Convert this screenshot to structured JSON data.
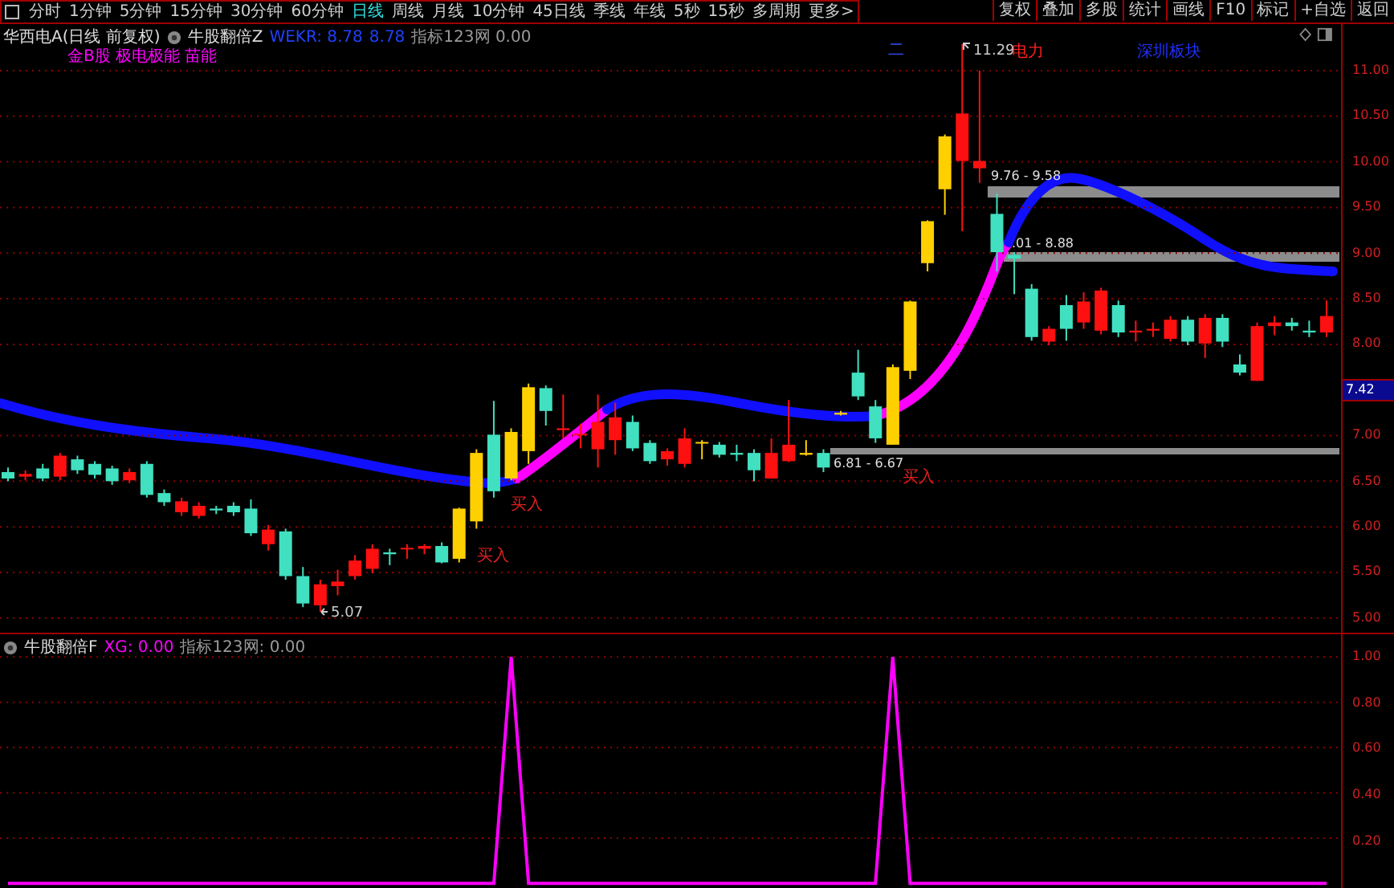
{
  "toolbar": {
    "periods": [
      {
        "label": "分时",
        "selected": false
      },
      {
        "label": "1分钟",
        "selected": false
      },
      {
        "label": "5分钟",
        "selected": false
      },
      {
        "label": "15分钟",
        "selected": false
      },
      {
        "label": "30分钟",
        "selected": false
      },
      {
        "label": "60分钟",
        "selected": false
      },
      {
        "label": "日线",
        "selected": true
      },
      {
        "label": "周线",
        "selected": false
      },
      {
        "label": "月线",
        "selected": false
      },
      {
        "label": "10分钟",
        "selected": false
      },
      {
        "label": "45日线",
        "selected": false
      },
      {
        "label": "季线",
        "selected": false
      },
      {
        "label": "年线",
        "selected": false
      },
      {
        "label": "5秒",
        "selected": false
      },
      {
        "label": "15秒",
        "selected": false
      },
      {
        "label": "多周期",
        "selected": false
      },
      {
        "label": "更多>",
        "selected": false
      }
    ],
    "buttons": [
      "复权",
      "叠加",
      "多股",
      "统计",
      "画线",
      "F10",
      "标记",
      "+自选",
      "返回"
    ]
  },
  "main_panel": {
    "header": {
      "security": "华西电A(日线 前复权)",
      "indicator": "牛股翻倍Z",
      "wekr": "WEKR: 8.78",
      "wekr_value_2": "8.78",
      "site_value": "指标123网 0.00"
    },
    "tags": "金B股 极电极能 苗能",
    "annotations": [
      {
        "kind": "mark",
        "text": "二"
      },
      {
        "kind": "price",
        "text": "11.29"
      },
      {
        "kind": "sector",
        "text": "电力"
      },
      {
        "kind": "sector",
        "text": "深圳板块"
      },
      {
        "kind": "price",
        "text": "5.07"
      },
      {
        "kind": "signal",
        "text": "买入"
      },
      {
        "kind": "signal",
        "text": "买入"
      },
      {
        "kind": "signal",
        "text": "买入"
      }
    ],
    "zones": [
      {
        "label": "9.76 - 9.58"
      },
      {
        "label": ".01 - 8.88"
      },
      {
        "label": "6.81 - 6.67"
      }
    ],
    "last_price": "7.42",
    "chart_data": {
      "type": "candlestick",
      "ylim": [
        4.84,
        11.51
      ],
      "grid": true,
      "yticks": [
        {
          "value": 11,
          "label": "11.00"
        },
        {
          "value": 10.5,
          "label": "10.50"
        },
        {
          "value": 10,
          "label": "10.00"
        },
        {
          "value": 9.5,
          "label": "9.50"
        },
        {
          "value": 9,
          "label": "9.00"
        },
        {
          "value": 8.5,
          "label": "8.50"
        },
        {
          "value": 8,
          "label": "8.00"
        },
        {
          "value": 7,
          "label": "7.00"
        },
        {
          "value": 6.5,
          "label": "6.50"
        },
        {
          "value": 6,
          "label": "6.00"
        },
        {
          "value": 5.5,
          "label": "5.50"
        },
        {
          "value": 5,
          "label": "5.00"
        }
      ],
      "ohlc": [
        [
          6.6,
          6.65,
          6.5,
          6.53
        ],
        [
          6.55,
          6.62,
          6.51,
          6.58
        ],
        [
          6.64,
          6.69,
          6.5,
          6.53
        ],
        [
          6.55,
          6.81,
          6.51,
          6.78
        ],
        [
          6.74,
          6.78,
          6.58,
          6.62
        ],
        [
          6.69,
          6.72,
          6.53,
          6.57
        ],
        [
          6.64,
          6.67,
          6.46,
          6.5
        ],
        [
          6.51,
          6.64,
          6.48,
          6.6
        ],
        [
          6.69,
          6.72,
          6.32,
          6.35
        ],
        [
          6.37,
          6.41,
          6.23,
          6.27
        ],
        [
          6.16,
          6.32,
          6.12,
          6.28
        ],
        [
          6.12,
          6.27,
          6.09,
          6.23
        ],
        [
          6.2,
          6.23,
          6.14,
          6.18
        ],
        [
          6.23,
          6.27,
          6.12,
          6.16
        ],
        [
          6.2,
          6.3,
          5.9,
          5.93
        ],
        [
          5.81,
          6.02,
          5.74,
          5.97
        ],
        [
          5.95,
          5.98,
          5.42,
          5.46
        ],
        [
          5.46,
          5.56,
          5.12,
          5.16
        ],
        [
          5.14,
          5.42,
          5.07,
          5.37
        ],
        [
          5.35,
          5.53,
          5.25,
          5.4
        ],
        [
          5.46,
          5.69,
          5.42,
          5.63
        ],
        [
          5.54,
          5.81,
          5.49,
          5.76
        ],
        [
          5.72,
          5.76,
          5.58,
          5.7
        ],
        [
          5.76,
          5.81,
          5.65,
          5.77
        ],
        [
          5.76,
          5.81,
          5.7,
          5.79
        ],
        [
          5.79,
          5.83,
          5.6,
          5.61
        ],
        [
          5.65,
          6.21,
          5.61,
          6.2
        ],
        [
          6.06,
          6.85,
          5.98,
          6.81
        ],
        [
          7.01,
          7.38,
          6.32,
          6.39
        ],
        [
          6.53,
          7.08,
          6.51,
          7.04
        ],
        [
          6.83,
          7.57,
          6.69,
          7.53
        ],
        [
          7.52,
          7.55,
          7.11,
          7.27
        ],
        [
          7.06,
          7.45,
          6.97,
          7.08
        ],
        [
          7.01,
          7.13,
          6.86,
          7.02
        ],
        [
          6.85,
          7.45,
          6.65,
          7.15
        ],
        [
          6.95,
          7.36,
          6.79,
          7.2
        ],
        [
          7.15,
          7.22,
          6.83,
          6.86
        ],
        [
          6.92,
          6.95,
          6.69,
          6.72
        ],
        [
          6.74,
          6.86,
          6.67,
          6.83
        ],
        [
          6.69,
          7.08,
          6.65,
          6.97
        ],
        [
          6.92,
          6.95,
          6.74,
          6.93
        ],
        [
          6.9,
          6.93,
          6.76,
          6.79
        ],
        [
          6.81,
          6.9,
          6.72,
          6.79
        ],
        [
          6.81,
          6.85,
          6.5,
          6.62
        ],
        [
          6.53,
          6.97,
          6.53,
          6.81
        ],
        [
          6.72,
          7.39,
          6.71,
          6.9
        ],
        [
          6.79,
          6.95,
          6.78,
          6.81
        ],
        [
          6.81,
          6.85,
          6.6,
          6.65
        ],
        [
          7.23,
          7.27,
          7.22,
          7.25
        ],
        [
          7.69,
          7.94,
          7.39,
          7.43
        ],
        [
          7.32,
          7.39,
          6.92,
          6.97
        ],
        [
          6.9,
          7.78,
          6.9,
          7.75
        ],
        [
          7.71,
          8.48,
          7.62,
          8.47
        ],
        [
          8.89,
          9.36,
          8.8,
          9.35
        ],
        [
          9.7,
          10.3,
          9.42,
          10.28
        ],
        [
          10.01,
          11.29,
          9.24,
          10.53
        ],
        [
          9.93,
          11.0,
          9.77,
          10.01
        ],
        [
          9.43,
          9.65,
          8.8,
          9.01
        ],
        [
          8.98,
          9.01,
          8.55,
          8.94
        ],
        [
          8.61,
          8.66,
          8.04,
          8.08
        ],
        [
          8.03,
          8.2,
          7.99,
          8.17
        ],
        [
          8.43,
          8.54,
          8.04,
          8.17
        ],
        [
          8.24,
          8.57,
          8.17,
          8.47
        ],
        [
          8.15,
          8.62,
          8.11,
          8.59
        ],
        [
          8.43,
          8.48,
          8.08,
          8.13
        ],
        [
          8.13,
          8.26,
          8.03,
          8.15
        ],
        [
          8.15,
          8.24,
          8.08,
          8.17
        ],
        [
          8.06,
          8.31,
          8.03,
          8.27
        ],
        [
          8.27,
          8.31,
          7.99,
          8.03
        ],
        [
          8.01,
          8.33,
          7.85,
          8.29
        ],
        [
          8.29,
          8.33,
          7.97,
          8.03
        ],
        [
          7.78,
          7.89,
          7.66,
          7.69
        ],
        [
          7.6,
          8.24,
          7.6,
          8.2
        ],
        [
          8.2,
          8.31,
          8.1,
          8.24
        ],
        [
          8.24,
          8.29,
          8.15,
          8.2
        ],
        [
          8.15,
          8.26,
          8.08,
          8.13
        ],
        [
          8.13,
          8.48,
          8.08,
          8.31
        ]
      ],
      "colors": [
        "#40e0c0",
        "#ff1010",
        "#40e0c0",
        "#ff1010",
        "#40e0c0",
        "#40e0c0",
        "#40e0c0",
        "#ff1010",
        "#40e0c0",
        "#40e0c0",
        "#ff1010",
        "#ff1010",
        "#40e0c0",
        "#40e0c0",
        "#40e0c0",
        "#ff1010",
        "#40e0c0",
        "#40e0c0",
        "#ff1010",
        "#ff1010",
        "#ff1010",
        "#ff1010",
        "#40e0c0",
        "#ff1010",
        "#ff1010",
        "#40e0c0",
        "#ffd000",
        "#ffd000",
        "#40e0c0",
        "#ffd000",
        "#ffd000",
        "#40e0c0",
        "#ff1010",
        "#ff1010",
        "#ff1010",
        "#ff1010",
        "#40e0c0",
        "#40e0c0",
        "#ff1010",
        "#ff1010",
        "#ffd000",
        "#40e0c0",
        "#40e0c0",
        "#40e0c0",
        "#ff1010",
        "#ff1010",
        "#ffd000",
        "#40e0c0",
        "#ffd000",
        "#40e0c0",
        "#40e0c0",
        "#ffd000",
        "#ffd000",
        "#ffd000",
        "#ffd000",
        "#ff1010",
        "#ff1010",
        "#40e0c0",
        "#40e0c0",
        "#40e0c0",
        "#ff1010",
        "#40e0c0",
        "#ff1010",
        "#ff1010",
        "#40e0c0",
        "#ff1010",
        "#ff1010",
        "#ff1010",
        "#40e0c0",
        "#ff1010",
        "#40e0c0",
        "#40e0c0",
        "#ff1010",
        "#ff1010",
        "#40e0c0",
        "#40e0c0",
        "#ff1010"
      ]
    }
  },
  "lower_panel": {
    "header": {
      "indicator": "牛股翻倍F",
      "xg": "XG: 0.00",
      "site_value": "指标123网: 0.00"
    },
    "chart_data": {
      "type": "line",
      "ylim": [
        -0.02,
        1.1
      ],
      "grid": true,
      "yticks": [
        {
          "value": 0.2,
          "label": "0.20"
        },
        {
          "value": 0.4,
          "label": "0.40"
        },
        {
          "value": 0.6,
          "label": "0.60"
        },
        {
          "value": 0.8,
          "label": "0.80"
        },
        {
          "value": 1,
          "label": "1.00"
        }
      ],
      "series": [
        {
          "color": "#ff00ff",
          "values": [
            0,
            0,
            0,
            0,
            0,
            0,
            0,
            0,
            0,
            0,
            0,
            0,
            0,
            0,
            0,
            0,
            0,
            0,
            0,
            0,
            0,
            0,
            0,
            0,
            0,
            0,
            0,
            0,
            0,
            1,
            0,
            0,
            0,
            0,
            0,
            0,
            0,
            0,
            0,
            0,
            0,
            0,
            0,
            0,
            0,
            0,
            0,
            0,
            0,
            0,
            0,
            1,
            0,
            0,
            0,
            0,
            0,
            0,
            0,
            0,
            0,
            0,
            0,
            0,
            0,
            0,
            0,
            0,
            0,
            0,
            0,
            0,
            0,
            0,
            0,
            0,
            0
          ]
        }
      ]
    }
  }
}
